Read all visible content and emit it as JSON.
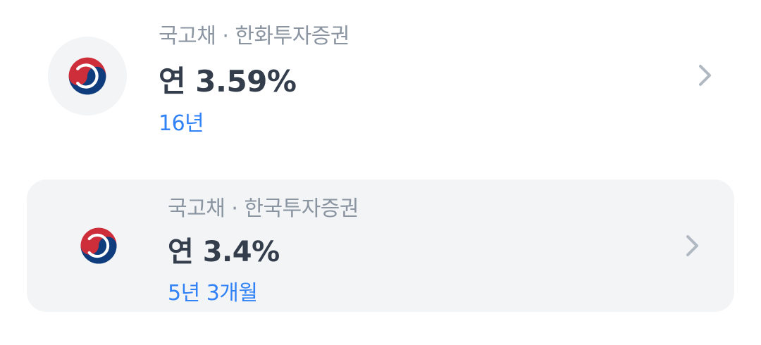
{
  "bonds": [
    {
      "issuer": "국고채 · 한화투자증권",
      "rate": "연 3.59%",
      "term": "16년",
      "emblem_icon": "korea-government-emblem-icon",
      "chevron_icon": "chevron-right-icon"
    },
    {
      "issuer": "국고채 · 한국투자증권",
      "rate": "연 3.4%",
      "term": "5년 3개월",
      "emblem_icon": "korea-government-emblem-icon",
      "chevron_icon": "chevron-right-icon"
    }
  ],
  "colors": {
    "title": "#333d4b",
    "subtitle": "#8b95a1",
    "accent": "#3182f6",
    "selected_background": "#f2f4f6",
    "emblem_red": "#cd2e3a",
    "emblem_blue": "#0f3c7d"
  }
}
